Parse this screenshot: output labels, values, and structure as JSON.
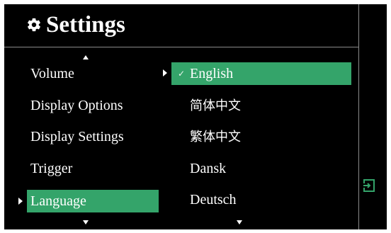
{
  "header": {
    "title": "Settings",
    "icon": "gear-icon"
  },
  "colors": {
    "background": "#000000",
    "selected": "#34a46a",
    "divider": "#8a8a8a",
    "text": "#ffffff"
  },
  "menu": {
    "items": [
      {
        "label": "Volume"
      },
      {
        "label": "Display Options"
      },
      {
        "label": "Display Settings"
      },
      {
        "label": "Trigger"
      },
      {
        "label": "Language"
      }
    ],
    "selected": "Language"
  },
  "submenu": {
    "items": [
      {
        "label": "English"
      },
      {
        "label": "简体中文"
      },
      {
        "label": "繁体中文"
      },
      {
        "label": "Dansk"
      },
      {
        "label": "Deutsch"
      }
    ],
    "selected": "English",
    "check_mark": "✓"
  },
  "side": {
    "icon": "exit-icon"
  }
}
